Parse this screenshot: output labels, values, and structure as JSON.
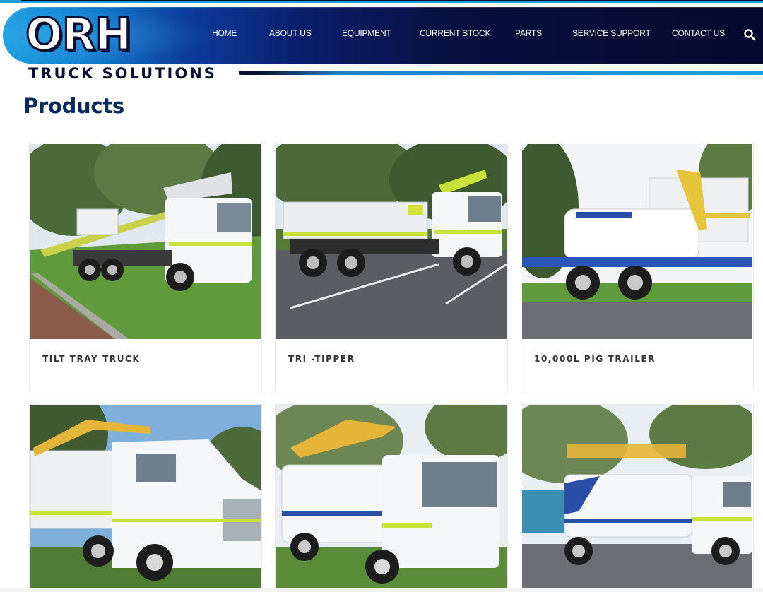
{
  "brand": {
    "logo": "ORH",
    "tagline": "TRUCK SOLUTIONS"
  },
  "nav": {
    "items": [
      {
        "label": "HOME"
      },
      {
        "label": "ABOUT US"
      },
      {
        "label": "EQUIPMENT"
      },
      {
        "label": "CURRENT STOCK"
      },
      {
        "label": "PARTS"
      },
      {
        "label": "SERVICE SUPPORT"
      },
      {
        "label": "CONTACT US"
      }
    ],
    "search_icon": "search-icon"
  },
  "page": {
    "title": "Products"
  },
  "products": [
    {
      "label": "TILT TRAY TRUCK",
      "image": "tilt-tray-truck-photo"
    },
    {
      "label": "TRI -TIPPER",
      "image": "tri-tipper-photo"
    },
    {
      "label": "10,000L PIG TRAILER",
      "image": "pig-trailer-photo"
    },
    {
      "label": "",
      "image": "mack-water-truck-photo"
    },
    {
      "label": "",
      "image": "hino-water-truck-photo"
    },
    {
      "label": "",
      "image": "isuzu-water-truck-photo"
    }
  ],
  "colors": {
    "nav_dark": "#050a2e",
    "nav_light": "#1b9ee0",
    "title": "#0b2a5c",
    "hivis": "#d7f542"
  }
}
